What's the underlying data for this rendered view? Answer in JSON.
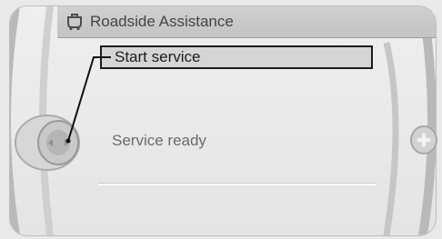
{
  "header": {
    "title": "Roadside Assistance",
    "icon": "assistance-icon"
  },
  "menu": {
    "selected_item_label": "Start service",
    "status_label": "Service ready"
  },
  "controls": {
    "controller_icon": "controller-knob-icon",
    "plus_icon": "plus-icon"
  }
}
